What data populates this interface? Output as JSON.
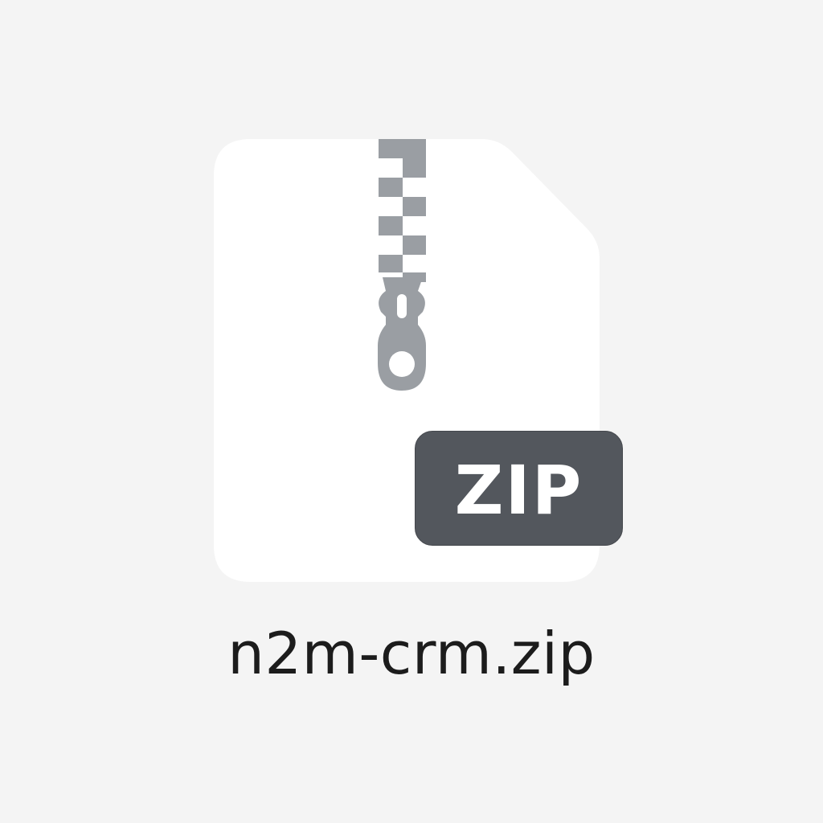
{
  "file": {
    "name": "n2m-crm.zip",
    "type_badge": "ZIP",
    "icon": "zip-archive-icon",
    "colors": {
      "background": "#f4f4f4",
      "page": "#ffffff",
      "zipper": "#9a9ea3",
      "badge": "#53575d",
      "badge_text": "#ffffff",
      "label_text": "#1c1c1c"
    }
  }
}
